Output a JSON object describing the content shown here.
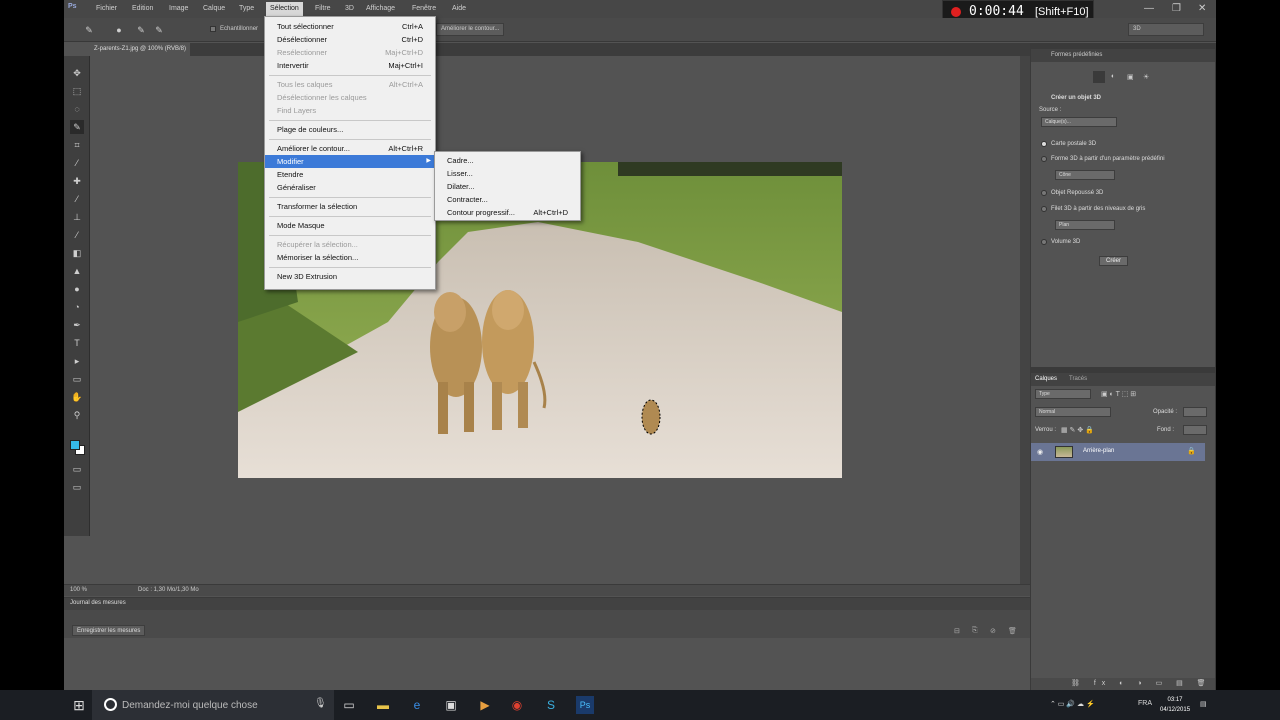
{
  "menubar": {
    "items": [
      "Fichier",
      "Edition",
      "Image",
      "Calque",
      "Type",
      "Sélection",
      "Filtre",
      "3D",
      "Affichage",
      "Fenêtre",
      "Aide"
    ],
    "active": "Sélection",
    "logo": "Ps"
  },
  "recorder": {
    "time": "0:00:44",
    "shortcut": "[Shift+F10]"
  },
  "optbar": {
    "sample_label": "Echantillonner",
    "refine_label": "Améliorer le contour...",
    "workspace": "3D"
  },
  "document": {
    "tab_label": "Z-parents-Z1.jpg @ 100% (RVB/8)"
  },
  "status": {
    "zoom": "100 %",
    "doc": "Doc : 1,30 Mo/1,30 Mo"
  },
  "history": {
    "title": "Journal des mesures",
    "record_button": "Enregistrer les mesures"
  },
  "props": {
    "header": "Formes prédéfinies",
    "title": "Créer un objet 3D",
    "source_label": "Source :",
    "source_value": "Calque(s)...",
    "options": [
      "Carte postale 3D",
      "Forme 3D à partir d'un paramètre prédéfini",
      "Objet Repoussé 3D",
      "Filet 3D à partir des niveaux de gris",
      "Volume 3D"
    ],
    "dropdown1": "Cône",
    "dropdown2": "Plan",
    "create_button": "Créer"
  },
  "layers": {
    "tabs": [
      "Calques",
      "Tracés"
    ],
    "kind": "Type",
    "blend": "Normal",
    "opacity_label": "Opacité :",
    "lock_label": "Verrou :",
    "fill_label": "Fond :",
    "layer_name": "Arrière-plan"
  },
  "menu_selection": {
    "items": [
      {
        "label": "Tout sélectionner",
        "shortcut": "Ctrl+A",
        "disabled": false
      },
      {
        "label": "Désélectionner",
        "shortcut": "Ctrl+D",
        "disabled": false
      },
      {
        "label": "Resélectionner",
        "shortcut": "Maj+Ctrl+D",
        "disabled": true
      },
      {
        "label": "Intervertir",
        "shortcut": "Maj+Ctrl+I",
        "disabled": false
      },
      {
        "label": "Tous les calques",
        "shortcut": "Alt+Ctrl+A",
        "disabled": true
      },
      {
        "label": "Désélectionner les calques",
        "shortcut": "",
        "disabled": true
      },
      {
        "label": "Find Layers",
        "shortcut": "",
        "disabled": true
      },
      {
        "label": "Plage de couleurs...",
        "shortcut": "",
        "disabled": false
      },
      {
        "label": "Améliorer le contour...",
        "shortcut": "Alt+Ctrl+R",
        "disabled": false
      },
      {
        "label": "Modifier",
        "shortcut": "",
        "disabled": false
      },
      {
        "label": "Etendre",
        "shortcut": "",
        "disabled": false
      },
      {
        "label": "Généraliser",
        "shortcut": "",
        "disabled": false
      },
      {
        "label": "Transformer la sélection",
        "shortcut": "",
        "disabled": false
      },
      {
        "label": "Mode Masque",
        "shortcut": "",
        "disabled": false
      },
      {
        "label": "Récupérer la sélection...",
        "shortcut": "",
        "disabled": true
      },
      {
        "label": "Mémoriser la sélection...",
        "shortcut": "",
        "disabled": false
      },
      {
        "label": "New 3D Extrusion",
        "shortcut": "",
        "disabled": false
      }
    ]
  },
  "menu_modifier": {
    "items": [
      {
        "label": "Cadre...",
        "shortcut": ""
      },
      {
        "label": "Lisser...",
        "shortcut": ""
      },
      {
        "label": "Dilater...",
        "shortcut": ""
      },
      {
        "label": "Contracter...",
        "shortcut": ""
      },
      {
        "label": "Contour progressif...",
        "shortcut": "Alt+Ctrl+D"
      }
    ]
  },
  "taskbar": {
    "search_placeholder": "Demandez-moi quelque chose",
    "lang": "FRA",
    "time": "03:17",
    "date": "04/12/2015"
  },
  "colors": {
    "foreground": "#35b8e8",
    "background": "#ffffff",
    "menu_highlight": "#3c7ad8"
  }
}
